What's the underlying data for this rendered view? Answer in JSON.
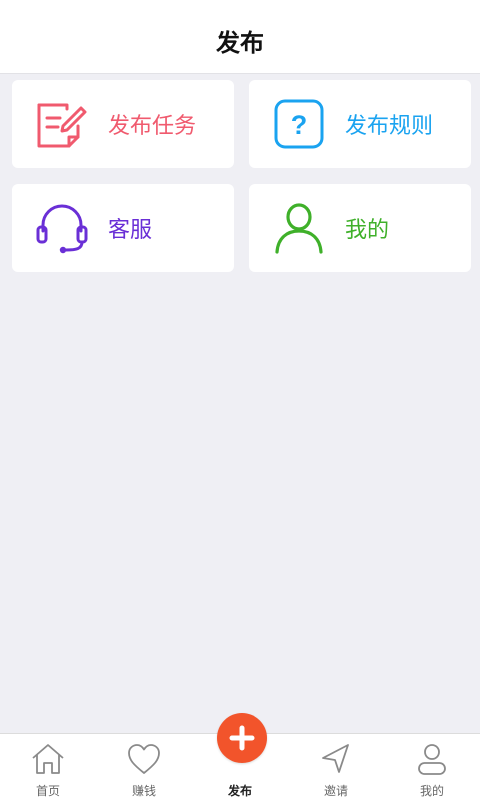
{
  "header": {
    "title": "发布"
  },
  "cards": [
    {
      "label": "发布任务",
      "icon": "edit-document-icon",
      "color": "#f05a6e"
    },
    {
      "label": "发布规则",
      "icon": "question-mark-icon",
      "color": "#1aa3f0"
    },
    {
      "label": "客服",
      "icon": "headset-icon",
      "color": "#6a2fd6"
    },
    {
      "label": "我的",
      "icon": "user-icon",
      "color": "#3fb02a"
    }
  ],
  "tabbar": {
    "items": [
      {
        "label": "首页",
        "icon": "home-icon"
      },
      {
        "label": "赚钱",
        "icon": "heart-icon"
      },
      {
        "label": "发布",
        "icon": "plus-icon",
        "active": true
      },
      {
        "label": "邀请",
        "icon": "send-icon"
      },
      {
        "label": "我的",
        "icon": "user-icon"
      }
    ],
    "fab_color": "#f2542b"
  }
}
